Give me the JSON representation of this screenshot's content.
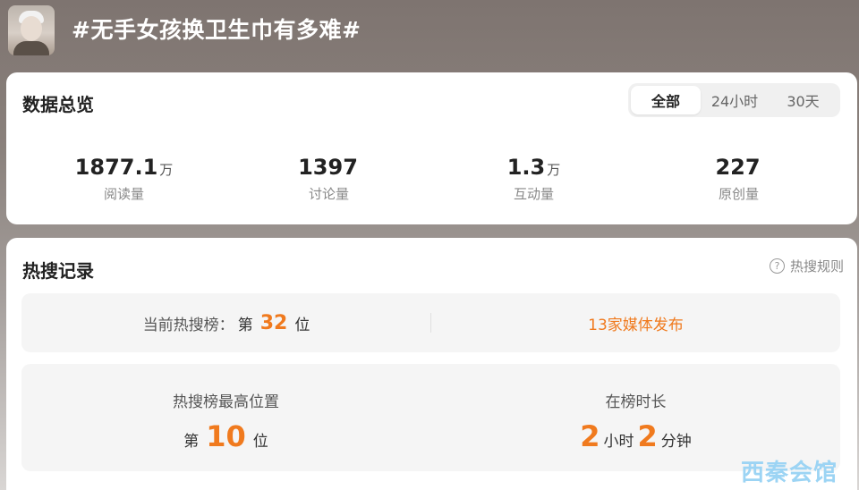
{
  "header": {
    "topic_title": "#无手女孩换卫生巾有多难#"
  },
  "overview": {
    "title": "数据总览",
    "tabs": [
      {
        "label": "全部",
        "active": true
      },
      {
        "label": "24小时",
        "active": false
      },
      {
        "label": "30天",
        "active": false
      }
    ],
    "stats": [
      {
        "value": "1877.1",
        "unit": "万",
        "label": "阅读量"
      },
      {
        "value": "1397",
        "unit": "",
        "label": "讨论量"
      },
      {
        "value": "1.3",
        "unit": "万",
        "label": "互动量"
      },
      {
        "value": "227",
        "unit": "",
        "label": "原创量"
      }
    ]
  },
  "hot_search": {
    "title": "热搜记录",
    "rules_label": "热搜规则",
    "current": {
      "prefix": "当前热搜榜：",
      "di": "第",
      "rank": "32",
      "wei": "位",
      "media_text": "13家媒体发布"
    },
    "peak": {
      "label": "热搜榜最高位置",
      "di": "第",
      "rank": "10",
      "wei": "位"
    },
    "duration": {
      "label": "在榜时长",
      "hours": "2",
      "hours_unit": "小时",
      "minutes": "2",
      "minutes_unit": "分钟"
    }
  },
  "watermark": {
    "text": "西秦会馆"
  },
  "colors": {
    "accent": "#f07a1e",
    "card_bg": "#ffffff",
    "panel_bg": "#f5f5f5"
  }
}
